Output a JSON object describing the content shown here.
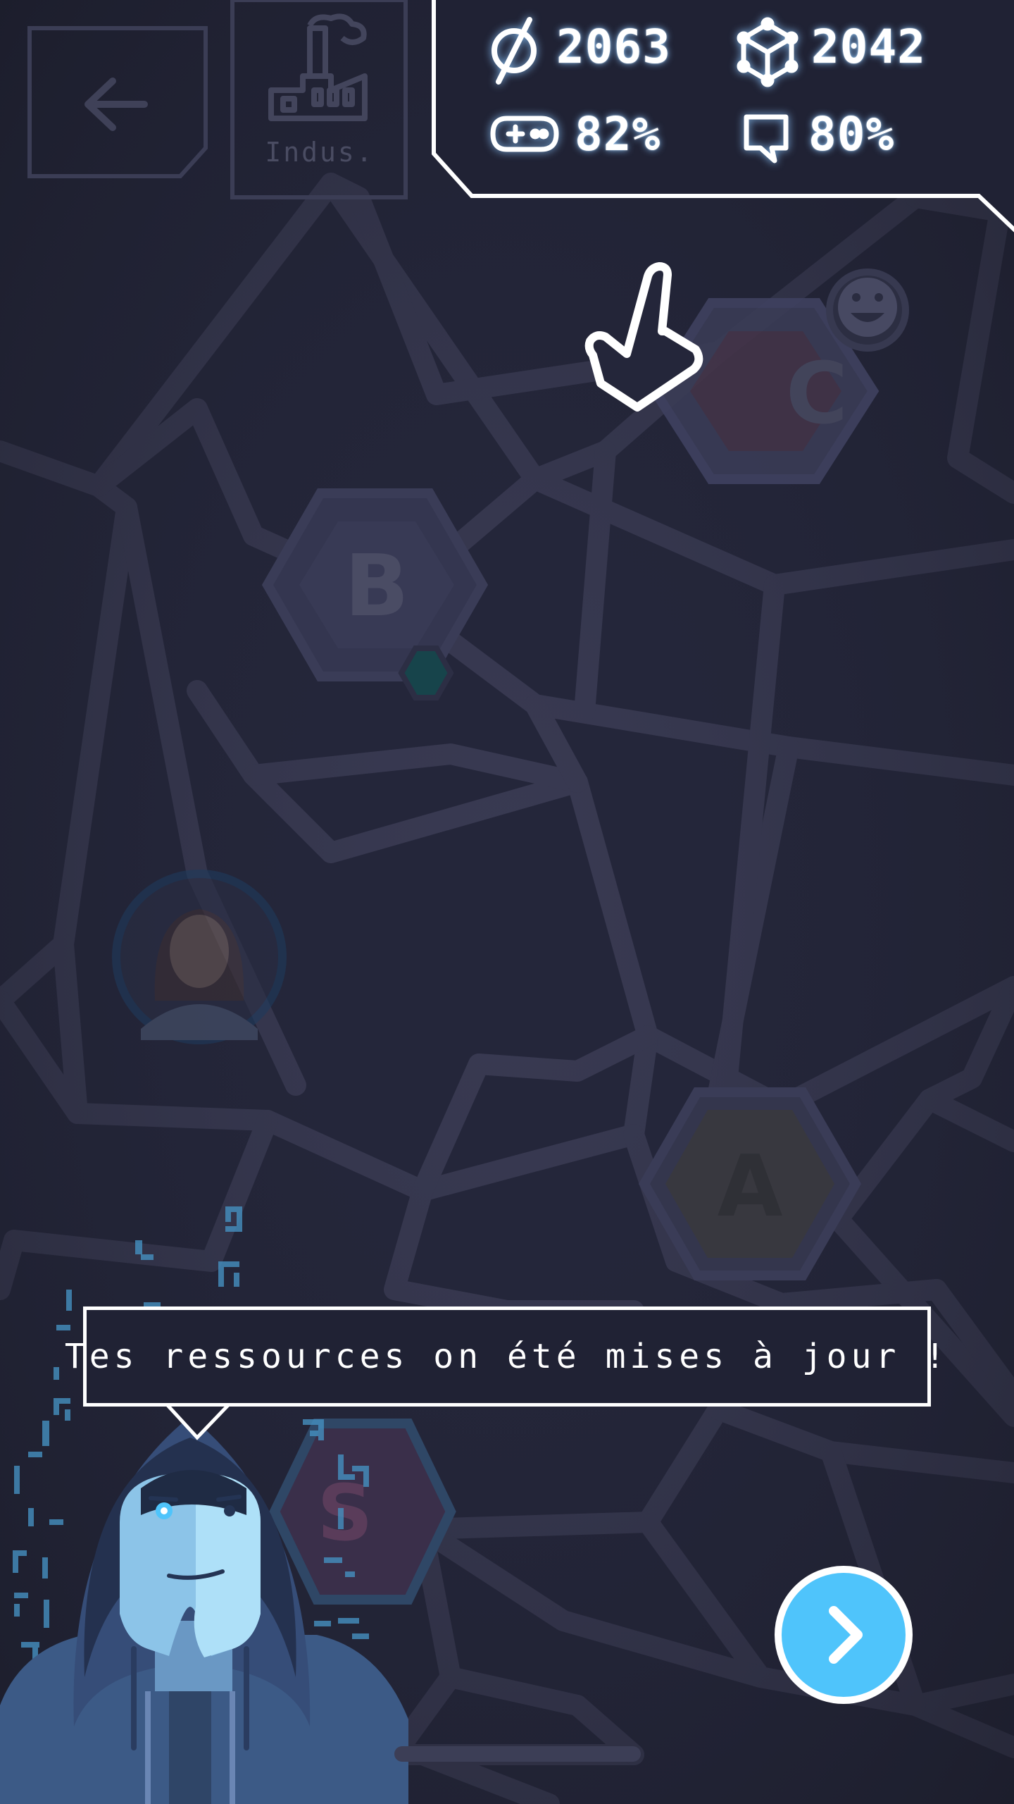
{
  "hud": {
    "money": "2063",
    "materials": "2042",
    "fun": "82%",
    "communication": "80%"
  },
  "top_left": {
    "indus_label": "Indus."
  },
  "map": {
    "zones": [
      {
        "letter": "C"
      },
      {
        "letter": "B"
      },
      {
        "letter": "A"
      },
      {
        "letter": "S"
      }
    ]
  },
  "dialog": {
    "text": "Tes ressources on été mises à jour !"
  },
  "colors": {
    "background": "#24263a",
    "road": "#393a52",
    "accent": "#4fc4fb",
    "hud_glow": "#8cc8ff"
  },
  "icons": {
    "back": "arrow-left-icon",
    "industry": "factory-icon",
    "money": "empty-set-icon",
    "materials": "cube-icon",
    "fun": "gamepad-icon",
    "communication": "speech-bubble-icon",
    "next": "chevron-right-icon",
    "tutorial": "pointing-hand-icon"
  }
}
